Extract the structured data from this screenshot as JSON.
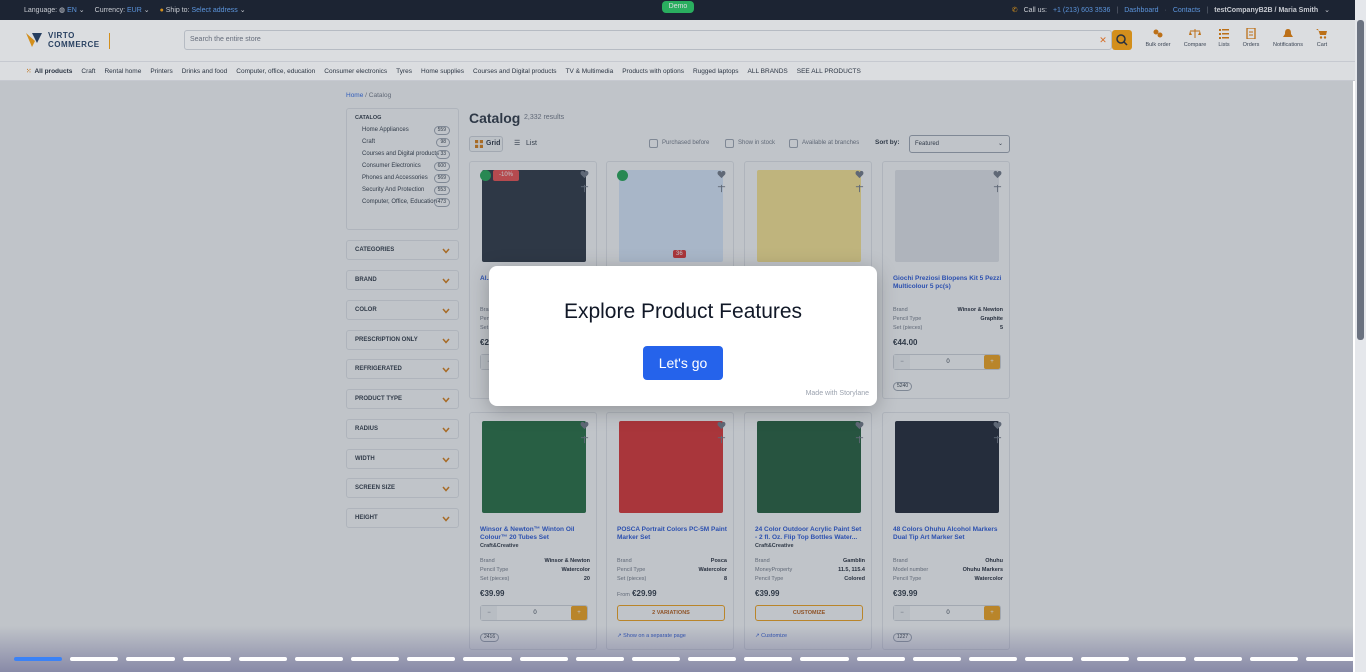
{
  "topbar": {
    "language_label": "Language:",
    "language_value": "EN",
    "currency_label": "Currency:",
    "currency_value": "EUR",
    "ship_label": "Ship to:",
    "ship_value": "Select address",
    "demo": "Demo",
    "call_label": "Call us:",
    "phone": "+1 (213) 603 3536",
    "dashboard": "Dashboard",
    "contacts": "Contacts",
    "account": "testCompanyB2B / Maria Smith"
  },
  "header": {
    "logo_line1": "VIRTO",
    "logo_line2": "COMMERCE",
    "search_placeholder": "Search the entire store",
    "icons": [
      {
        "label": "Bulk order",
        "icon": "bulk-order-icon"
      },
      {
        "label": "Compare",
        "icon": "compare-icon"
      },
      {
        "label": "Lists",
        "icon": "lists-icon"
      },
      {
        "label": "Orders",
        "icon": "orders-icon"
      },
      {
        "label": "Notifications",
        "icon": "bell-icon"
      },
      {
        "label": "Cart",
        "icon": "cart-icon"
      }
    ]
  },
  "nav": {
    "all_products": "All products",
    "items": [
      "Craft",
      "Rental home",
      "Printers",
      "Drinks and food",
      "Computer, office, education",
      "Consumer electronics",
      "Tyres",
      "Home supplies",
      "Courses and Digital products",
      "TV & Multimedia",
      "Products with options",
      "Rugged laptops",
      "ALL BRANDS",
      "SEE ALL PRODUCTS"
    ]
  },
  "breadcrumb": {
    "home": "Home",
    "current": "Catalog"
  },
  "sidebar": {
    "catalog_title": "CATALOG",
    "categories": [
      {
        "name": "Home Appliances",
        "count": "559"
      },
      {
        "name": "Craft",
        "count": "98"
      },
      {
        "name": "Courses and Digital products",
        "count": "33"
      },
      {
        "name": "Consumer Electronics",
        "count": "600"
      },
      {
        "name": "Phones and Accessories",
        "count": "569"
      },
      {
        "name": "Security And Protection",
        "count": "553"
      },
      {
        "name": "Computer, Office, Education",
        "count": "473"
      }
    ],
    "facets": [
      "CATEGORIES",
      "BRAND",
      "COLOR",
      "PRESCRIPTION ONLY",
      "REFRIGERATED",
      "PRODUCT TYPE",
      "RADIUS",
      "WIDTH",
      "SCREEN SIZE",
      "HEIGHT"
    ]
  },
  "catalog": {
    "title": "Catalog",
    "count": "2,332 results",
    "grid_label": "Grid",
    "list_label": "List",
    "filters": [
      "Purchased before",
      "Show in stock",
      "Available at branches"
    ],
    "sort_label": "Sort by:",
    "sort_value": "Featured"
  },
  "products": [
    {
      "name": "Al... Pro...",
      "vendor": "",
      "props": [
        {
          "k": "Brand",
          "v": ""
        },
        {
          "k": "Pencil",
          "v": ""
        },
        {
          "k": "Set",
          "v": ""
        }
      ],
      "price": "€2...",
      "from": "",
      "action": "qty",
      "qty": "",
      "sku": "",
      "link": "",
      "discount": "-10%",
      "check": true,
      "img_color": "#1f2937"
    },
    {
      "name": "",
      "vendor": "",
      "props": [],
      "price": "",
      "from": "",
      "action": "none",
      "qty": "",
      "sku": "",
      "link": "",
      "discount": "",
      "check": true,
      "img_color": "#dbeafe",
      "tag": "36"
    },
    {
      "name": "",
      "vendor": "",
      "props": [],
      "price": "",
      "from": "",
      "action": "none",
      "qty": "",
      "sku": "",
      "link": "",
      "discount": "",
      "check": false,
      "img_color": "#fde68a"
    },
    {
      "name": "Giochi Preziosi Blopens Kit 5 Pezzi Multicolour 5 pc(s)",
      "vendor": "",
      "props": [
        {
          "k": "Brand",
          "v": "Winsor & Newton"
        },
        {
          "k": "Pencil Type",
          "v": "Graphite"
        },
        {
          "k": "Set (pieces)",
          "v": "5"
        }
      ],
      "price": "€44.00",
      "from": "",
      "action": "qty",
      "qty": "0",
      "sku": "5240",
      "link": "",
      "discount": "",
      "check": false,
      "img_color": "#e5e7eb"
    },
    {
      "name": "Winsor & Newton™ Winton Oil Colour™ 20 Tubes Set",
      "vendor": "Craft&Creative",
      "props": [
        {
          "k": "Brand",
          "v": "Winsor & Newton"
        },
        {
          "k": "Pencil Type",
          "v": "Watercolor"
        },
        {
          "k": "Set (pieces)",
          "v": "20"
        }
      ],
      "price": "€39.99",
      "from": "",
      "action": "qty",
      "qty": "0",
      "sku": "2416",
      "link": "",
      "discount": "",
      "check": false,
      "img_color": "#166534"
    },
    {
      "name": "POSCA Portrait Colors PC-5M Paint Marker Set",
      "vendor": "",
      "props": [
        {
          "k": "Brand",
          "v": "Posca"
        },
        {
          "k": "Pencil Type",
          "v": "Watercolor"
        },
        {
          "k": "Set (pieces)",
          "v": "8"
        }
      ],
      "price": "€29.99",
      "from": "From",
      "action": "2 VARIATIONS",
      "qty": "",
      "sku": "",
      "link": "Show on a separate page",
      "discount": "",
      "check": false,
      "img_color": "#dc2626"
    },
    {
      "name": "24 Color Outdoor Acrylic Paint Set - 2 fl. Oz. Flip Top Bottles Water...",
      "vendor": "Craft&Creative",
      "props": [
        {
          "k": "Brand",
          "v": "Gamblin"
        },
        {
          "k": "MoneyProperty",
          "v": "11.5, 115.4"
        },
        {
          "k": "Pencil Type",
          "v": "Colored"
        }
      ],
      "price": "€39.99",
      "from": "",
      "action": "CUSTOMIZE",
      "qty": "",
      "sku": "",
      "link": "Customize",
      "discount": "",
      "check": false,
      "img_color": "#14532d"
    },
    {
      "name": "48 Colors Ohuhu Alcohol Markers Dual Tip Art Marker Set",
      "vendor": "",
      "props": [
        {
          "k": "Brand",
          "v": "Ohuhu"
        },
        {
          "k": "Model number",
          "v": "Ohuhu Markers"
        },
        {
          "k": "Pencil Type",
          "v": "Watercolor"
        }
      ],
      "price": "€39.99",
      "from": "",
      "action": "qty",
      "qty": "0",
      "sku": "1227",
      "link": "",
      "discount": "",
      "check": false,
      "img_color": "#111827"
    }
  ],
  "modal": {
    "title": "Explore Product Features",
    "button": "Let's go",
    "footer": "Made with Storylane"
  },
  "colors": {
    "accent": "#f59e0b",
    "link": "#1d4ed8",
    "primary_button": "#2563eb",
    "topbar": "#111827"
  }
}
